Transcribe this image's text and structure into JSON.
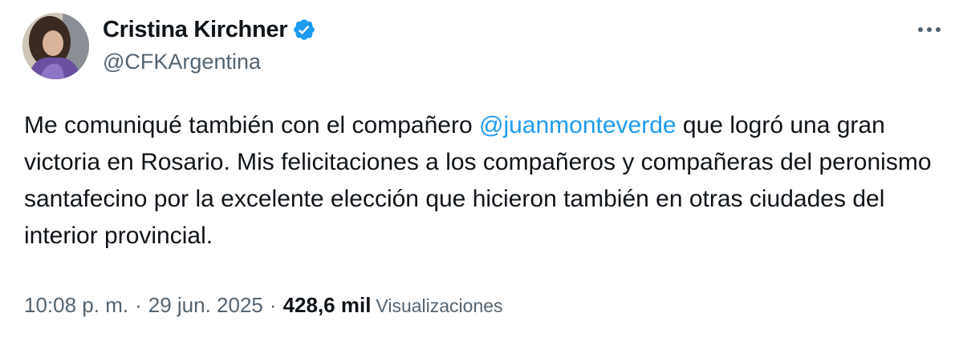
{
  "author": {
    "display_name": "Cristina Kirchner",
    "handle": "@CFKArgentina",
    "verified": true,
    "verified_color": "#1d9bf0"
  },
  "tweet": {
    "text_before_mention": "Me comuniqué también con el compañero ",
    "mention": "@juanmonteverde",
    "text_after_mention": " que logró una gran victoria en Rosario. Mis felicitaciones a los compañeros y compañeras del peronismo santafecino por la excelente elección que hicieron también en otras ciudades del interior provincial.",
    "time": "10:08 p. m.",
    "separator": "·",
    "date": "29 jun. 2025",
    "views_count": "428,6 mil",
    "views_label": "Visualizaciones"
  },
  "icons": {
    "more": "more-horizontal-icon",
    "verified": "verified-badge-icon"
  },
  "colors": {
    "text": "#0f1419",
    "secondary": "#536471",
    "link": "#1d9bf0"
  }
}
